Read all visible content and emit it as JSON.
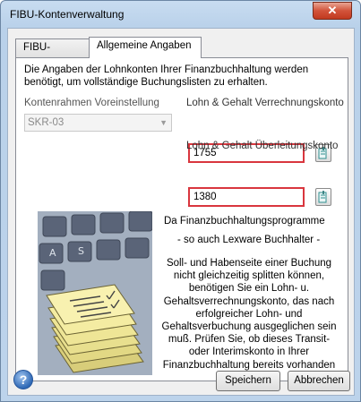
{
  "window": {
    "title": "FIBU-Kontenverwaltung",
    "close_glyph": "✕"
  },
  "tabs": [
    {
      "label": "FIBU-Konten"
    },
    {
      "label": "Allgemeine Angaben"
    }
  ],
  "intro_text": "Die Angaben der Lohnkonten Ihrer Finanzbuchhaltung werden benötigt, um vollständige Buchungslisten zu erhalten.",
  "kontenrahmen": {
    "label": "Kontenrahmen Voreinstellung",
    "value": "SKR-03"
  },
  "verrechnung": {
    "label": "Lohn & Gehalt Verrechnungskonto",
    "value": "1755"
  },
  "ueberleitung": {
    "label": "Lohn & Gehalt Überleitungskonto",
    "value": "1380"
  },
  "info": {
    "title": "Da Finanzbuchhaltungsprogramme",
    "subtitle": "- so auch Lexware Buchhalter -",
    "body": "Soll- und Habenseite einer Buchung nicht gleichzeitig splitten können, benötigen Sie ein Lohn- u. Gehaltsverrechnungskonto, das nach erfolgreicher Lohn- und Gehaltsverbuchung ausgeglichen sein muß. Prüfen Sie, ob dieses Transit- oder Interimskonto in Ihrer Finanzbuchhaltung bereits vorhanden ist."
  },
  "help_glyph": "?",
  "buttons": {
    "save": "Speichern",
    "cancel": "Abbrechen"
  },
  "colors": {
    "highlight_border": "#d9363e",
    "accent_blue": "#2f69b6"
  }
}
